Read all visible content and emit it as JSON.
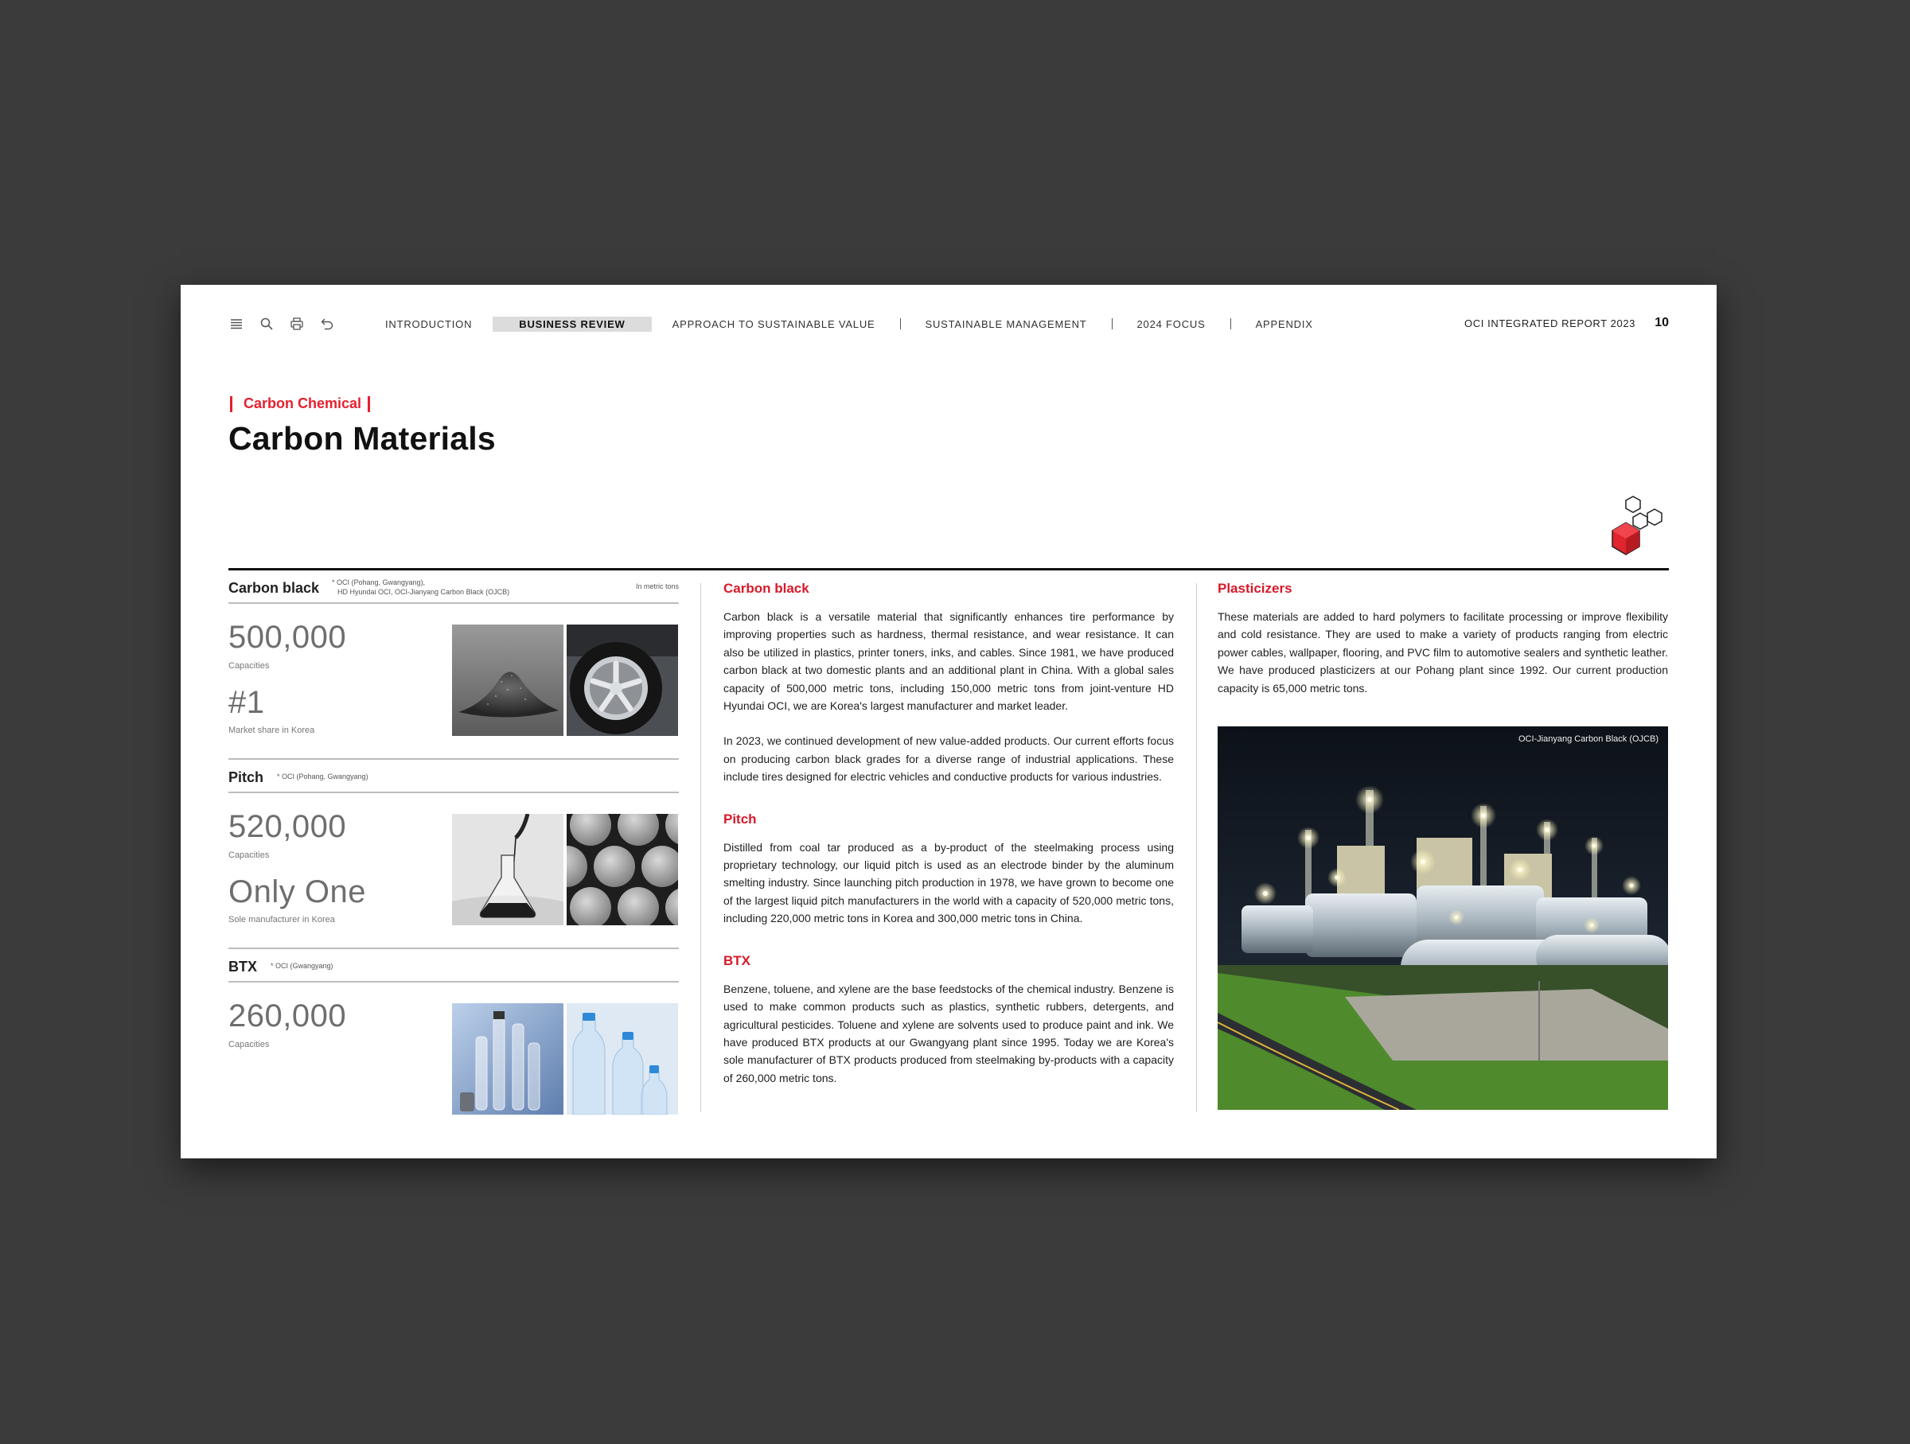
{
  "toolbar": {
    "menu_icon": "menu-icon",
    "search_icon": "search-icon",
    "print_icon": "print-icon",
    "back_icon": "back-icon"
  },
  "nav": {
    "items": [
      "INTRODUCTION",
      "BUSINESS REVIEW",
      "APPROACH TO SUSTAINABLE VALUE",
      "SUSTAINABLE MANAGEMENT",
      "2024 FOCUS",
      "APPENDIX"
    ],
    "active": "BUSINESS REVIEW"
  },
  "header": {
    "report_title": "OCI INTEGRATED REPORT 2023",
    "page_number": "10",
    "eyebrow": "Carbon Chemical",
    "title": "Carbon Materials"
  },
  "colors": {
    "accent": "#e5202f",
    "heading_red": "#d7192a",
    "stat_gray": "#6e6e6e"
  },
  "left": {
    "carbon_black": {
      "name": "Carbon black",
      "note_line1": "* OCI (Pohang, Gwangyang),",
      "note_line2": "HD Hyundai OCI, OCI-Jianyang Carbon Black (OJCB)",
      "unit": "In metric tons",
      "stat1_value": "500,000",
      "stat1_label": "Capacities",
      "stat2_value": "#1",
      "stat2_label": "Market share in Korea"
    },
    "pitch": {
      "name": "Pitch",
      "note": "* OCI (Pohang, Gwangyang)",
      "stat1_value": "520,000",
      "stat1_label": "Capacities",
      "stat2_value": "Only One",
      "stat2_label": "Sole manufacturer in Korea"
    },
    "btx": {
      "name": "BTX",
      "note": "* OCI (Gwangyang)",
      "stat1_value": "260,000",
      "stat1_label": "Capacities"
    }
  },
  "middle": {
    "carbon_black_heading": "Carbon black",
    "carbon_black_p1": "Carbon black is a versatile material that significantly enhances tire performance by improving properties such as hardness, thermal resistance, and wear resistance. It can also be utilized in plastics, printer toners, inks, and cables. Since 1981, we have produced carbon black at two domestic plants and an additional plant in China. With a global sales capacity of 500,000 metric tons, including 150,000 metric tons from joint-venture HD Hyundai OCI, we are Korea's largest manufacturer and market leader.",
    "carbon_black_p2": "In 2023, we continued development of new value-added products. Our current efforts focus on producing carbon black grades for a diverse range of industrial applications. These include tires designed for electric vehicles and conductive products for various industries.",
    "pitch_heading": "Pitch",
    "pitch_p": "Distilled from coal tar produced as a by-product of the steelmaking process using proprietary technology, our liquid pitch is used as an electrode binder by the aluminum smelting industry. Since launching pitch production in 1978, we have grown to become one of the largest liquid pitch manufacturers in the world with a capacity of 520,000 metric tons, including 220,000 metric tons in Korea and 300,000 metric tons in China.",
    "btx_heading": "BTX",
    "btx_p": "Benzene, toluene, and xylene are the base feedstocks of the chemical industry. Benzene is used to make common products such as plastics, synthetic rubbers, detergents, and agricultural pesticides. Toluene and xylene are solvents used to produce paint and ink. We have produced BTX products at our Gwangyang plant since 1995. Today we are Korea's sole manufacturer of BTX products produced from steelmaking by-products with a capacity of 260,000 metric tons."
  },
  "right": {
    "plasticizers_heading": "Plasticizers",
    "plasticizers_p": "These materials are added to hard polymers to facilitate processing or improve flexibility and cold resistance. They are used to make a variety of products ranging from electric power cables, wallpaper, flooring, and PVC film to automotive sealers and synthetic leather. We have produced plasticizers at our Pohang plant since 1992. Our current production capacity is 65,000 metric tons.",
    "photo_caption": "OCI-Jianyang Carbon Black (OJCB)"
  }
}
